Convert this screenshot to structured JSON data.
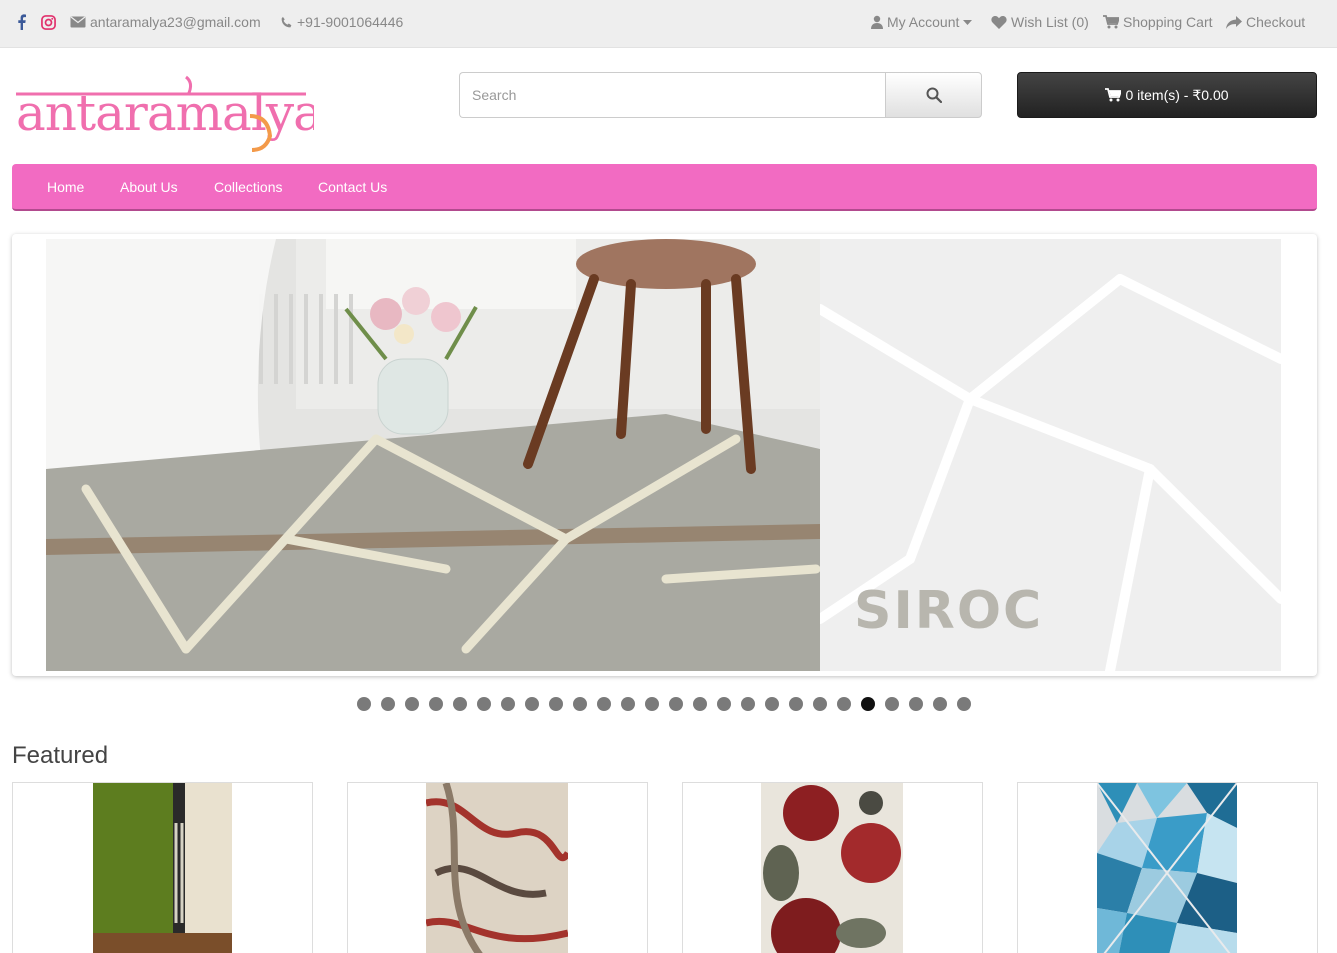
{
  "topbar": {
    "email": "antaramalya23@gmail.com",
    "phone": "+91-9001064446",
    "my_account": "My Account",
    "wish_list": "Wish List (0)",
    "shopping_cart": "Shopping Cart",
    "checkout": "Checkout"
  },
  "header": {
    "logo_text": "antaramalya",
    "search_placeholder": "Search",
    "cart_label": "0 item(s) - ₹0.00"
  },
  "menu": {
    "items": [
      {
        "label": "Home"
      },
      {
        "label": "About Us"
      },
      {
        "label": "Collections"
      },
      {
        "label": "Contact Us"
      }
    ]
  },
  "slider": {
    "brand_text": "SIROC",
    "slide_count": 26,
    "active_index": 21
  },
  "featured": {
    "title": "Featured"
  },
  "colors": {
    "menu_bg": "#f26bc2",
    "logo_pink": "#f06fae",
    "logo_orange": "#f39a4a",
    "cart_bg": "#2b2b2b"
  }
}
